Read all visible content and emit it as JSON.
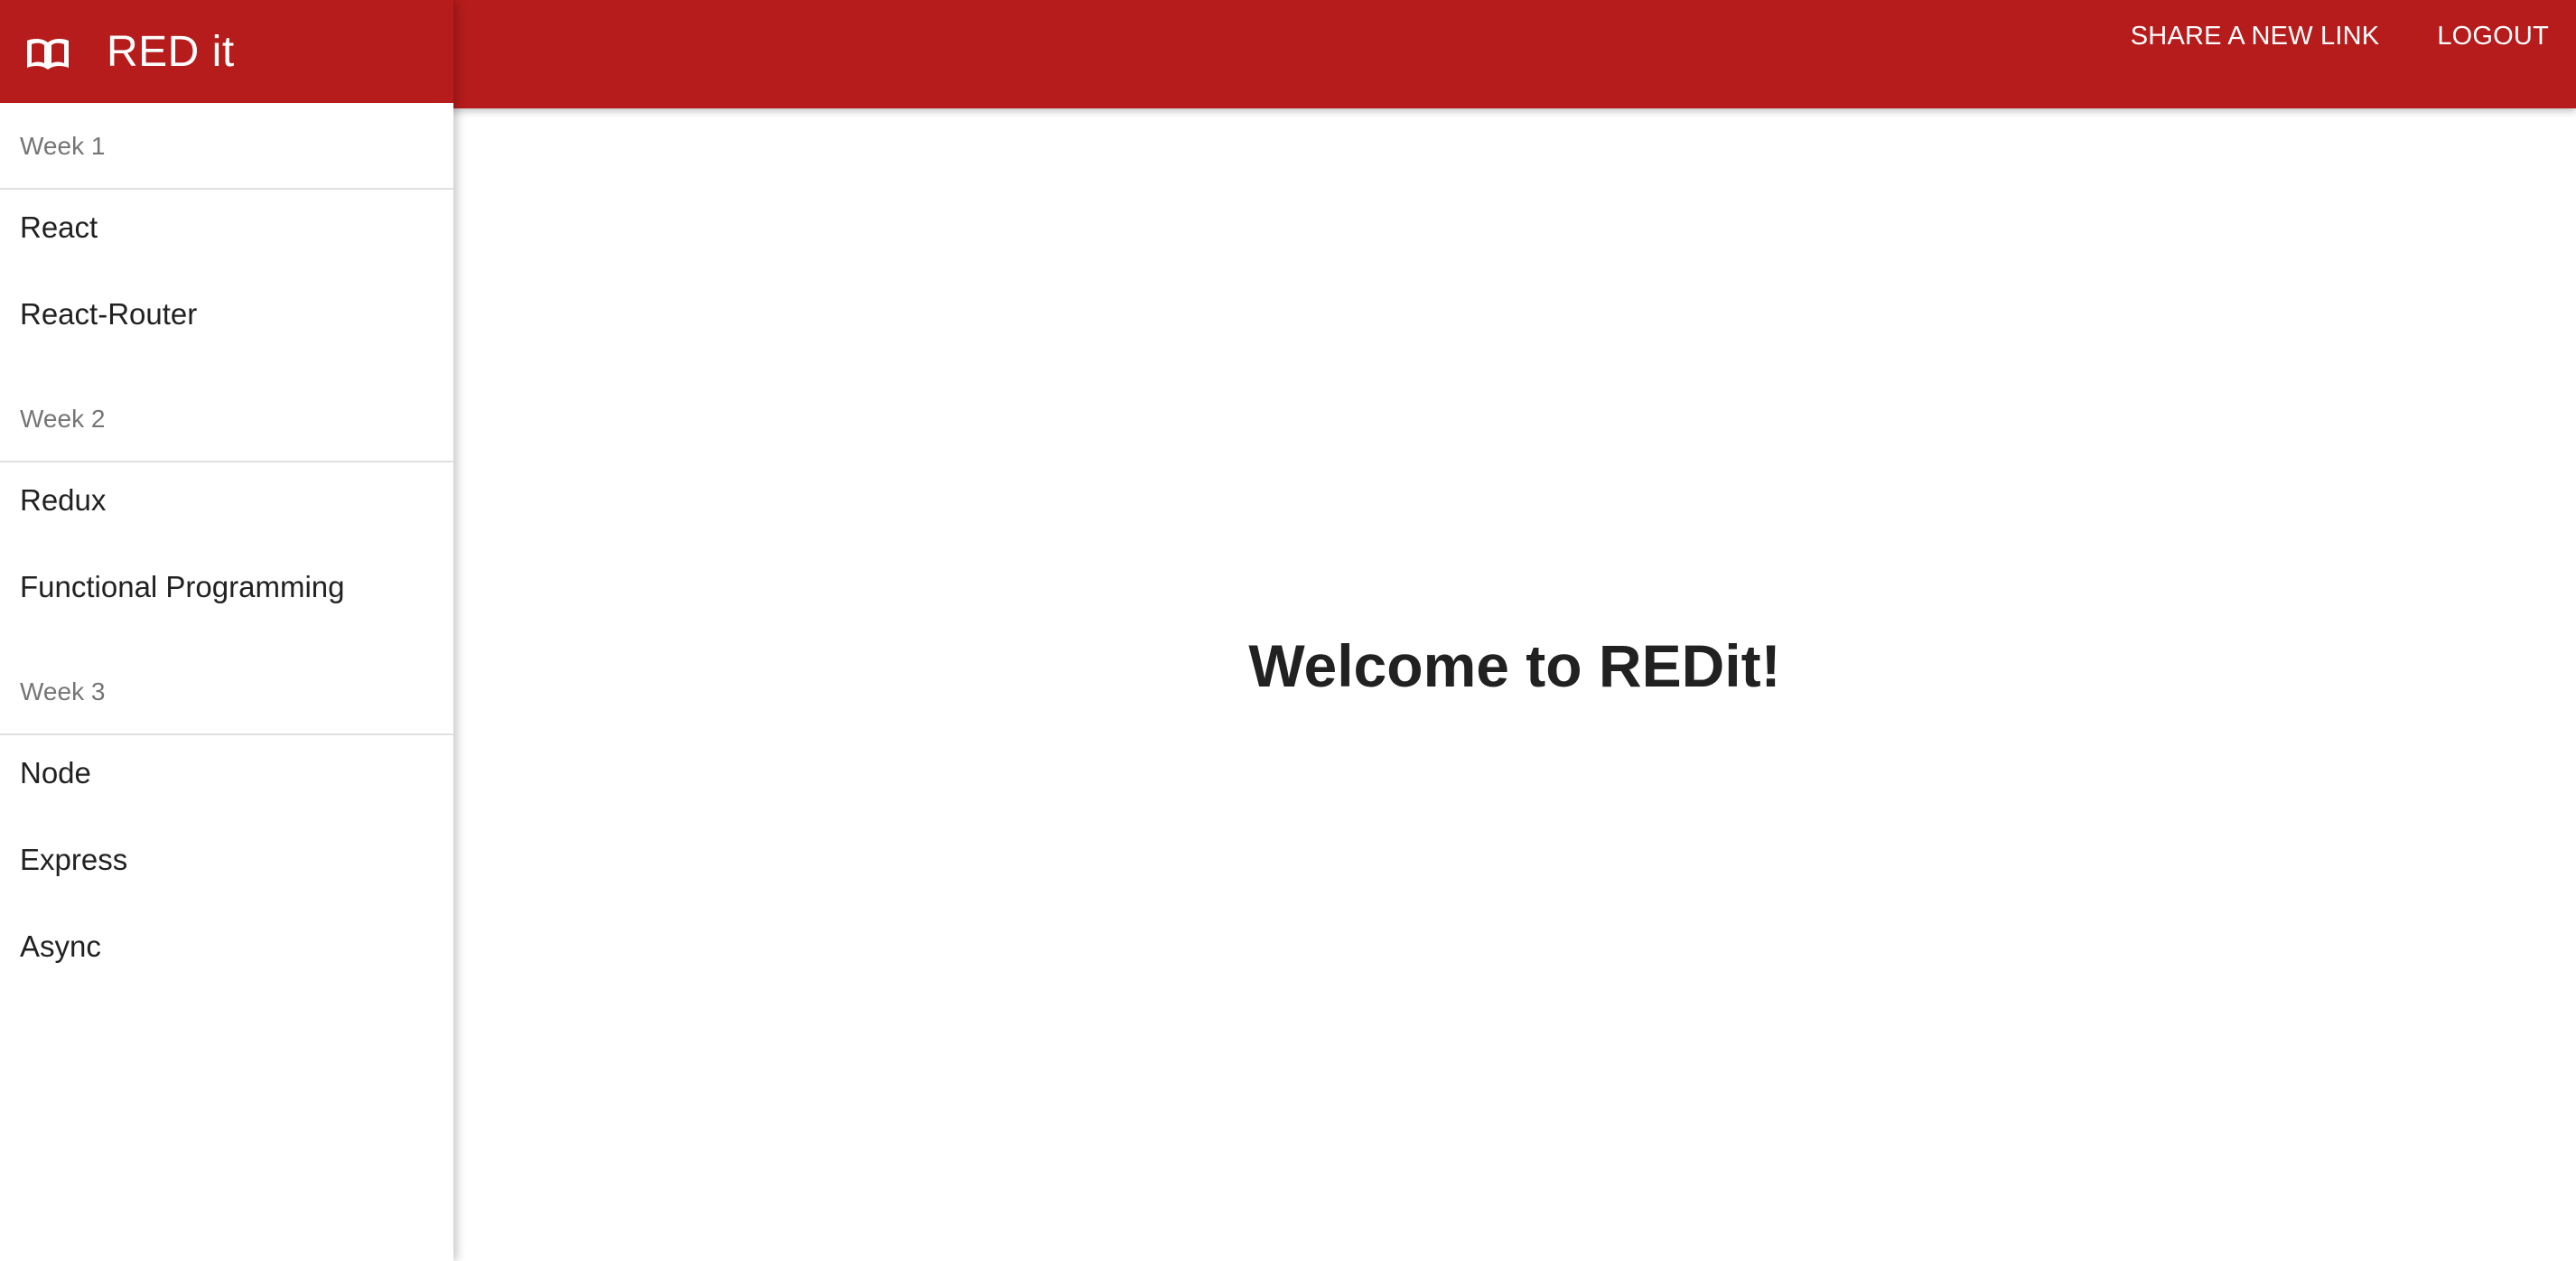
{
  "app": {
    "title": "RED it",
    "brand_color": "#b71c1c",
    "icon": "book-icon"
  },
  "nav": {
    "share_label": "SHARE A NEW LINK",
    "logout_label": "LOGOUT"
  },
  "sidebar": {
    "sections": [
      {
        "header": "Week 1",
        "items": [
          {
            "label": "React"
          },
          {
            "label": "React-Router"
          }
        ]
      },
      {
        "header": "Week 2",
        "items": [
          {
            "label": "Redux"
          },
          {
            "label": "Functional Programming"
          }
        ]
      },
      {
        "header": "Week 3",
        "items": [
          {
            "label": "Node"
          },
          {
            "label": "Express"
          },
          {
            "label": "Async"
          }
        ]
      }
    ]
  },
  "main": {
    "heading": "Welcome to REDit!"
  }
}
